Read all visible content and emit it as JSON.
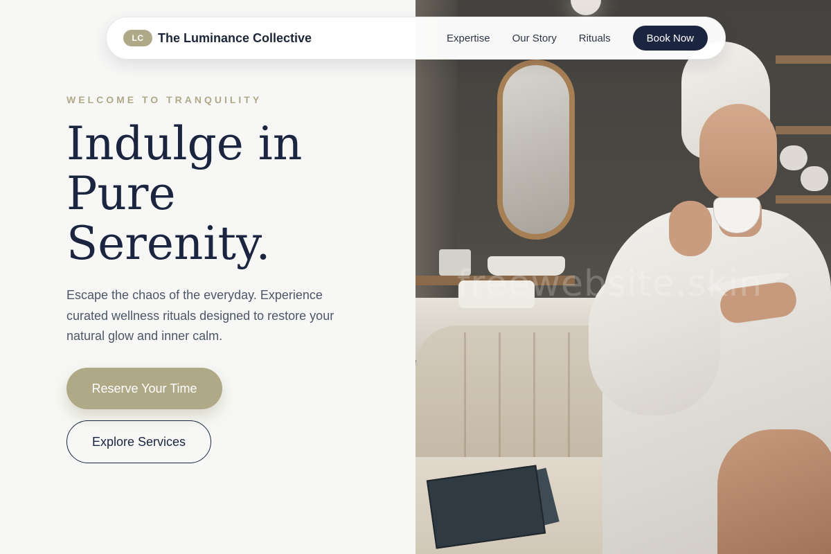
{
  "brand": {
    "badge": "LC",
    "name": "The Luminance Collective"
  },
  "nav": {
    "links": [
      "Expertise",
      "Our Story",
      "Rituals"
    ],
    "cta": "Book Now"
  },
  "hero": {
    "eyebrow": "WELCOME TO TRANQUILITY",
    "headline_lines": [
      "Indulge in",
      "Pure",
      "Serenity."
    ],
    "subtext": "Escape the chaos of the everyday. Experience curated wellness rituals designed to restore your natural glow and inner calm.",
    "primary_button": "Reserve Your Time",
    "secondary_button": "Explore Services"
  },
  "image": {
    "watermark": "freewebsite.skin"
  },
  "colors": {
    "accent": "#b0a987",
    "navy": "#1b2540",
    "background": "#f7f8f6"
  }
}
